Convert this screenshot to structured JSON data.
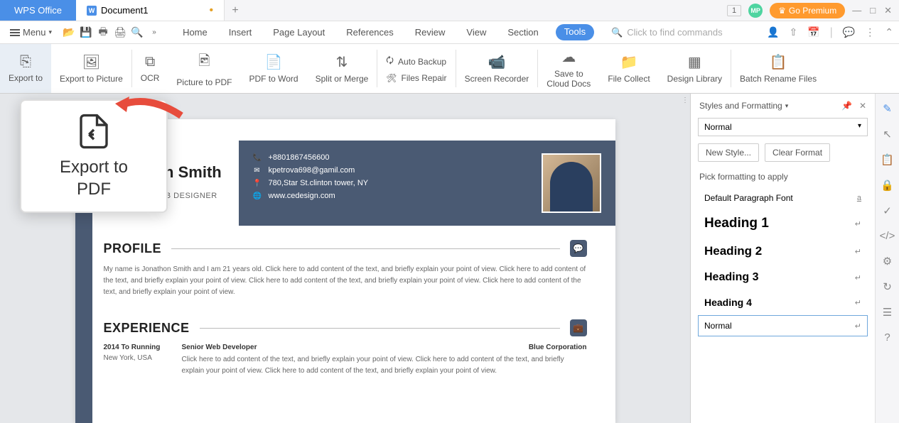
{
  "titlebar": {
    "wps_label": "WPS Office",
    "doc_label": "Document1",
    "num_badge": "1",
    "avatar": "MP",
    "premium_label": "Go Premium"
  },
  "menubar": {
    "menu_label": "Menu",
    "tabs": [
      "Home",
      "Insert",
      "Page Layout",
      "References",
      "Review",
      "View",
      "Section",
      "Tools"
    ],
    "search_placeholder": "Click to find commands"
  },
  "ribbon": {
    "export_to": "Export to",
    "export_picture": "Export to Picture",
    "ocr": "OCR",
    "picture_pdf": "Picture to PDF",
    "pdf_word": "PDF to Word",
    "split_merge": "Split or Merge",
    "auto_backup": "Auto Backup",
    "files_repair": "Files Repair",
    "screen_recorder": "Screen Recorder",
    "save_cloud_1": "Save to",
    "save_cloud_2": "Cloud Docs",
    "file_collect": "File Collect",
    "design_library": "Design Library",
    "batch_rename": "Batch Rename Files"
  },
  "callout": {
    "line1": "Export to",
    "line2": "PDF"
  },
  "document": {
    "name": "Jonathon Smith",
    "role": "GRAPHIC & WEB DESIGNER",
    "phone": "+8801867456600",
    "email": "kpetrova698@gamil.com",
    "address": "780,Star St.clinton tower, NY",
    "website": "www.cedesign.com",
    "profile_title": "PROFILE",
    "profile_text": "My name is Jonathon Smith and I am 21 years old. Click here to add content of the text, and briefly explain your point of view. Click here to add content of the text, and briefly explain your point of view. Click here to add content of the text, and briefly explain your point of view. Click here to add content of the text, and briefly explain your point of view.",
    "experience_title": "EXPERIENCE",
    "exp_date": "2014 To Running",
    "exp_loc": "New York, USA",
    "exp_role": "Senior Web Developer",
    "exp_company": "Blue Corporation",
    "exp_desc": "Click here to add content of the text, and briefly explain your point of view. Click here to add content of the text, and briefly explain your point of view. Click here to add content of the text, and briefly explain your point of view."
  },
  "sidepanel": {
    "title": "Styles and Formatting",
    "dropdown": "Normal",
    "new_style": "New Style...",
    "clear_format": "Clear Format",
    "pick_label": "Pick formatting to apply",
    "styles": {
      "dpf": "Default Paragraph Font",
      "h1": "Heading 1",
      "h2": "Heading 2",
      "h3": "Heading 3",
      "h4": "Heading 4",
      "normal": "Normal"
    },
    "dpf_mark": "a"
  }
}
